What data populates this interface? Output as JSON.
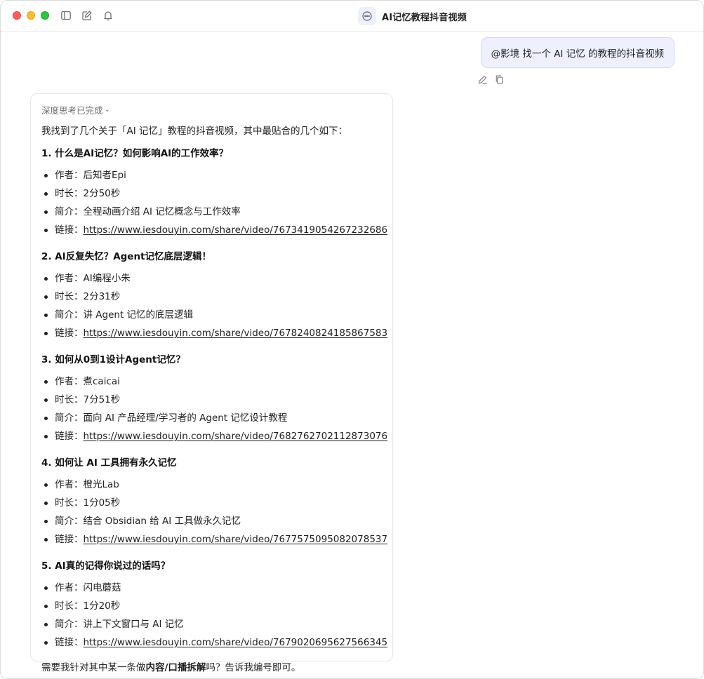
{
  "window": {
    "title": "AI记忆教程抖音视频"
  },
  "user_message": {
    "text": "@影境 找一个 AI 记忆 的教程的抖音视频"
  },
  "answer": {
    "thinking_label": "深度思考已完成",
    "intro": "我找到了几个关于「AI 记忆」教程的抖音视频，其中最贴合的几个如下：",
    "sections": [
      {
        "title": "1. 什么是AI记忆？如何影响AI的工作效率？",
        "author_label": "作者：",
        "author": "后知者Epi",
        "duration_label": "时长：",
        "duration": "2分50秒",
        "summary_label": "简介：",
        "summary": "全程动画介绍 AI 记忆概念与工作效率",
        "link_label": "链接：",
        "link": "https://www.iesdouyin.com/share/video/7673419054267232686"
      },
      {
        "title": "2. AI反复失忆？Agent记忆底层逻辑！",
        "author_label": "作者：",
        "author": "AI编程小朱",
        "duration_label": "时长：",
        "duration": "2分31秒",
        "summary_label": "简介：",
        "summary": "讲 Agent 记忆的底层逻辑",
        "link_label": "链接：",
        "link": "https://www.iesdouyin.com/share/video/7678240824185867583"
      },
      {
        "title": "3. 如何从0到1设计Agent记忆？",
        "author_label": "作者：",
        "author": "煮caicai",
        "duration_label": "时长：",
        "duration": "7分51秒",
        "summary_label": "简介：",
        "summary": "面向 AI 产品经理/学习者的 Agent 记忆设计教程",
        "link_label": "链接：",
        "link": "https://www.iesdouyin.com/share/video/7682762702112873076"
      },
      {
        "title": "4. 如何让 AI 工具拥有永久记忆",
        "author_label": "作者：",
        "author": "橙光Lab",
        "duration_label": "时长：",
        "duration": "1分05秒",
        "summary_label": "简介：",
        "summary": "结合 Obsidian 给 AI 工具做永久记忆",
        "link_label": "链接：",
        "link": "https://www.iesdouyin.com/share/video/7677575095082078537"
      },
      {
        "title": "5. AI真的记得你说过的话吗？",
        "author_label": "作者：",
        "author": "闪电蘑菇",
        "duration_label": "时长：",
        "duration": "1分20秒",
        "summary_label": "简介：",
        "summary": "讲上下文窗口与 AI 记忆",
        "link_label": "链接：",
        "link": "https://www.iesdouyin.com/share/video/7679020695627566345"
      }
    ],
    "outro_prefix": "需要我针对其中某一条做",
    "outro_bold": "内容/口播拆解",
    "outro_suffix": "吗？告诉我编号即可。"
  },
  "icons": {
    "sidebar": "sidebar-toggle-icon",
    "compose": "compose-icon",
    "bell": "bell-icon",
    "app": "chat-bubble-icon",
    "edit": "pencil-icon",
    "copy": "copy-icon"
  },
  "colors": {
    "accent_bg": "#eef0fe",
    "accent_border": "#d5d9f7",
    "close": "#fe5f57",
    "minimize": "#febc2e",
    "zoom": "#28c840"
  }
}
